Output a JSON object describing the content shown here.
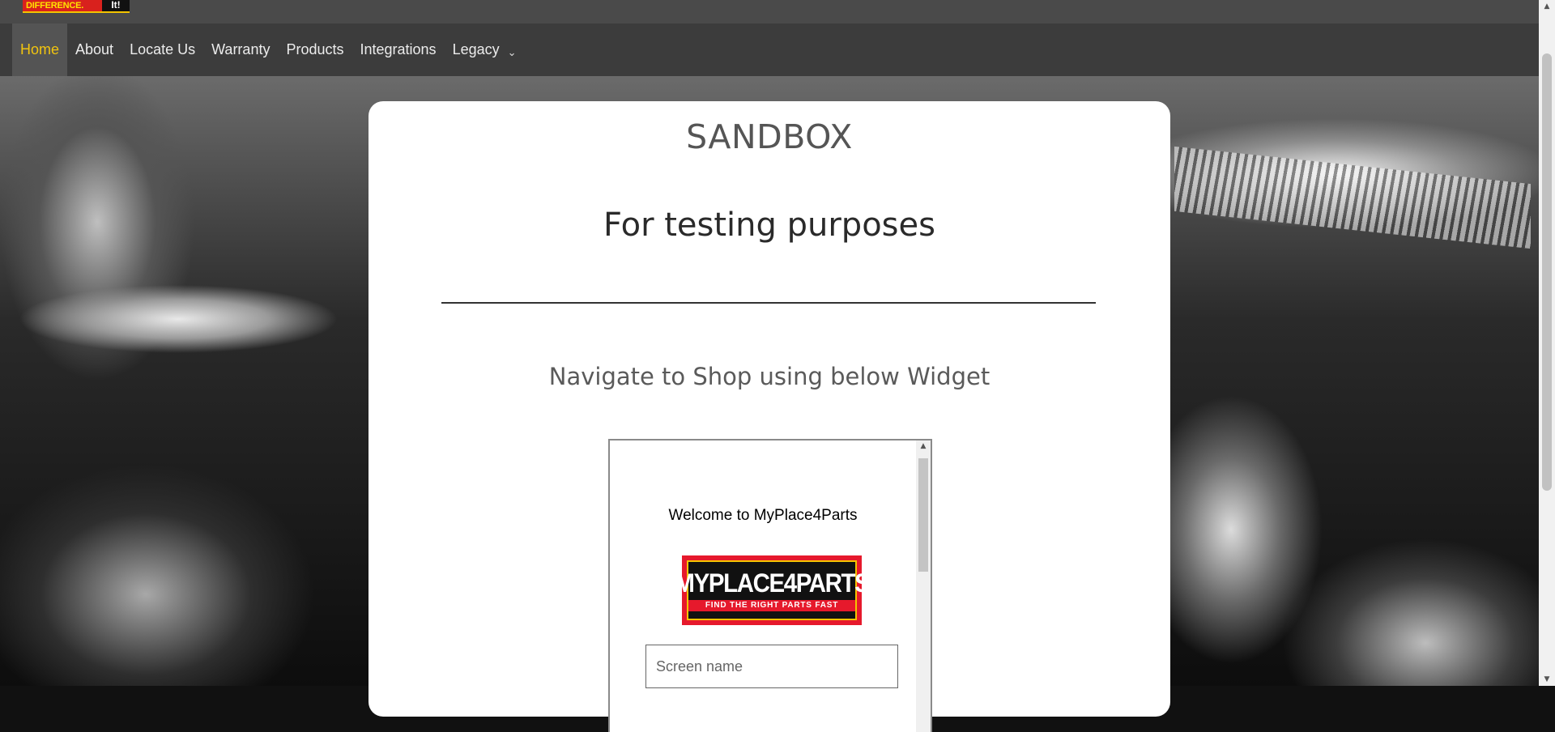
{
  "header": {
    "logo_text": "DIFFERENCE.",
    "logo_mark": "It!"
  },
  "nav": {
    "items": [
      {
        "label": "Home",
        "active": true
      },
      {
        "label": "About"
      },
      {
        "label": "Locate Us"
      },
      {
        "label": "Warranty"
      },
      {
        "label": "Products"
      },
      {
        "label": "Integrations"
      },
      {
        "label": "Legacy",
        "has_dropdown": true
      }
    ],
    "dropdown_icon": "chevron-down-icon",
    "active_color": "#f1c40f"
  },
  "main": {
    "title": "SANDBOX",
    "subtitle": "For testing purposes",
    "instruction": "Navigate to Shop using below Widget"
  },
  "widget": {
    "welcome": "Welcome to MyPlace4Parts",
    "logo_name": "MYPLACE4PARTS",
    "logo_tagline": "FIND THE RIGHT PARTS FAST",
    "screen_name_placeholder": "Screen name",
    "screen_name_value": ""
  }
}
